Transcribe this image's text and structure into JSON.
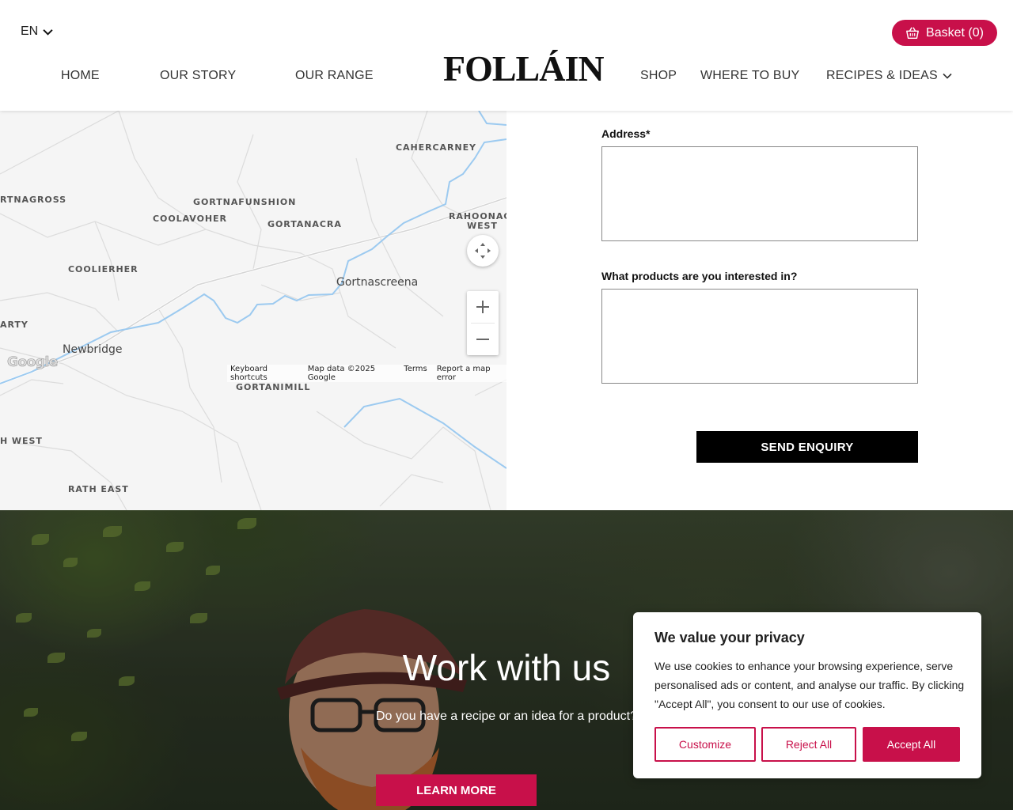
{
  "header": {
    "language": "EN",
    "basket_label": "Basket (0)",
    "logo_text": "FOLLÁIN",
    "nav": {
      "home": "HOME",
      "our_story": "OUR STORY",
      "our_range": "OUR RANGE",
      "shop": "SHOP",
      "where_to_buy": "WHERE TO BUY",
      "recipes": "RECIPES & IDEAS"
    }
  },
  "map": {
    "places": {
      "cahercarney": "CAHERCARNEY",
      "rtnagross": "RTNAGROSS",
      "gortnafunshion": "GORTNAFUNSHION",
      "coolavoher": "COOLAVOHER",
      "gortanacra": "GORTANACRA",
      "rahoonag": "RAHOONAG",
      "west": "WEST",
      "coolierher": "COOLIERHER",
      "arty": "ARTY",
      "gortanimill": "GORTANIMILL",
      "h_west": "H WEST",
      "rath_east": "RATH EAST"
    },
    "towns": {
      "gortnascreena": "Gortnascreena",
      "newbridge": "Newbridge"
    },
    "google_logo": "Google",
    "attribution": {
      "shortcuts": "Keyboard shortcuts",
      "map_data": "Map data ©2025 Google",
      "terms": "Terms",
      "report": "Report a map error"
    },
    "zoom_in": "+",
    "zoom_out": "—"
  },
  "form": {
    "address_label": "Address*",
    "products_label": "What products are you interested in?",
    "address_value": "",
    "products_value": "",
    "send_label": "SEND ENQUIRY"
  },
  "hero": {
    "title": "Work with us",
    "subtitle": "Do you have a recipe or an idea for a product?",
    "button_label": "LEARN MORE"
  },
  "cookie": {
    "title": "We value your privacy",
    "text": "We use cookies to enhance your browsing experience, serve personalised ads or content, and analyse our traffic. By clicking \"Accept All\", you consent to our use of cookies.",
    "customize": "Customize",
    "reject": "Reject All",
    "accept": "Accept All"
  },
  "colors": {
    "brand": "#c8104a",
    "button_dark": "#000000",
    "map_water": "#9ccaf0"
  }
}
